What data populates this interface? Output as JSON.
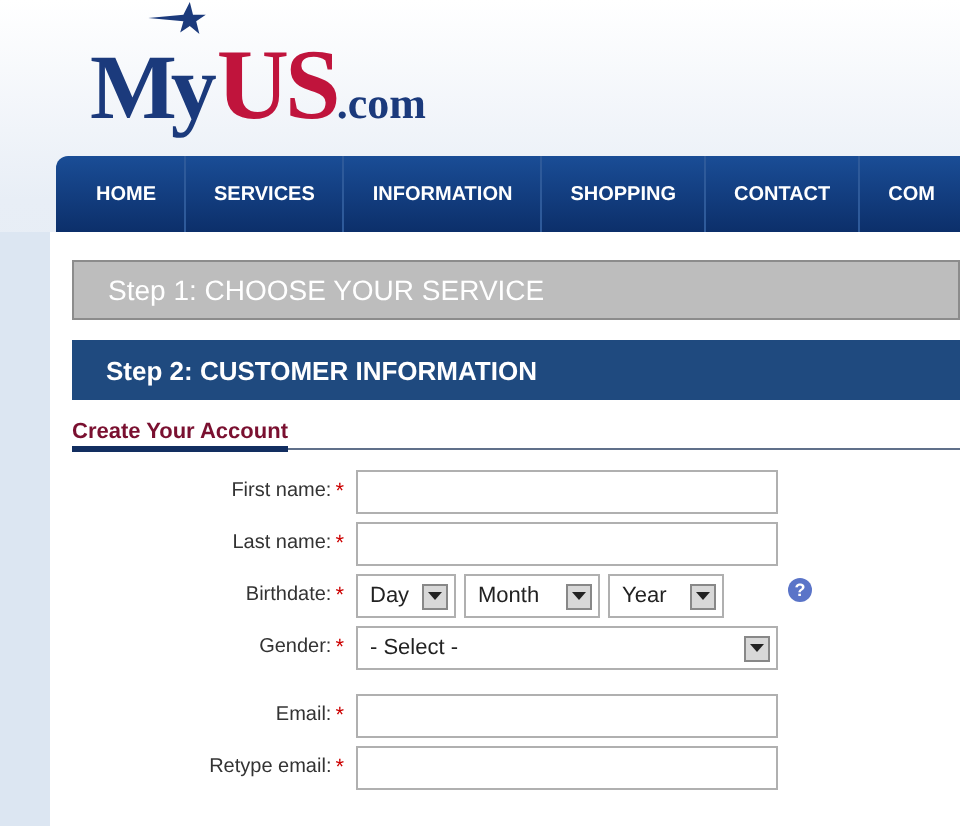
{
  "logo": {
    "part_1": "My",
    "part_2": "US",
    "part_3": ".com"
  },
  "nav": [
    {
      "label": "HOME"
    },
    {
      "label": "SERVICES"
    },
    {
      "label": "INFORMATION"
    },
    {
      "label": "SHOPPING"
    },
    {
      "label": "CONTACT"
    },
    {
      "label": "COM"
    }
  ],
  "steps": [
    {
      "label": "Step 1: CHOOSE YOUR SERVICE",
      "selected": false
    },
    {
      "label": "Step 2: CUSTOMER INFORMATION",
      "selected": true
    }
  ],
  "section_title": "Create Your Account",
  "fields": [
    {
      "kind": "text",
      "label": "First name:",
      "required": "*"
    },
    {
      "kind": "text",
      "label": "Last name:",
      "required": "*"
    },
    {
      "kind": "date",
      "label": "Birthdate:",
      "required": "*",
      "selects": [
        "Day",
        "Month",
        "Year"
      ],
      "help": "?"
    },
    {
      "kind": "select",
      "label": "Gender:",
      "required": "*",
      "value": "- Select -"
    },
    {
      "kind": "text",
      "label": "Email:",
      "required": "*"
    },
    {
      "kind": "text",
      "label": "Retype email:",
      "required": "*"
    }
  ]
}
